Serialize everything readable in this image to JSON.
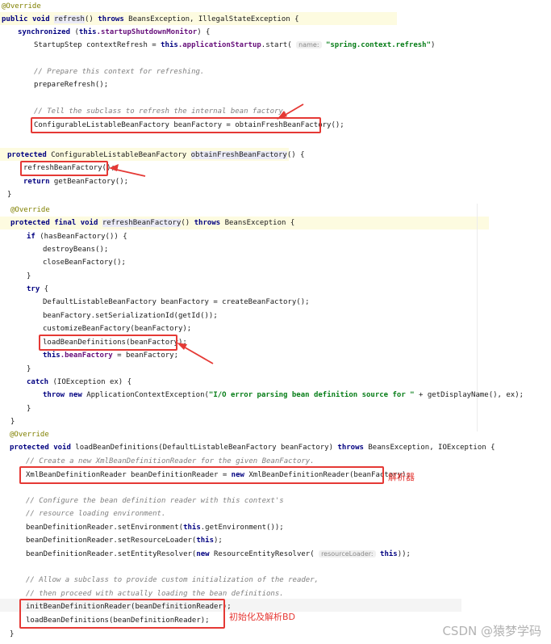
{
  "code": {
    "override": "@Override",
    "l1_public": "public",
    "l1_void": "void",
    "l1_refresh": "refresh",
    "l1_paren": "() ",
    "l1_throws": "throws",
    "l1_rest": " BeansException, IllegalStateException {",
    "l2_sync": "synchronized",
    "l2_paren": " (",
    "l2_this": "this",
    "l2_field": ".startupShutdownMonitor",
    "l2_rest": ") {",
    "l3_a": "StartupStep contextRefresh = ",
    "l3_this": "this",
    "l3_field": ".applicationStartup",
    "l3_b": ".start( ",
    "l3_hint": "name:",
    "l3_str": "\"spring.context.refresh\"",
    "l3_c": ")",
    "l4_cmt": "// Prepare this context for refreshing.",
    "l5": "prepareRefresh();",
    "l6_cmt": "// Tell the subclass to refresh the internal bean factory.",
    "l7": "ConfigurableListableBeanFactory beanFactory = obtainFreshBeanFactory();",
    "m2_protected": "protected",
    "m2_type": " ConfigurableListableBeanFactory ",
    "m2_name": "obtainFreshBeanFactory",
    "m2_rest": "() {",
    "m2_l1": "refreshBeanFactory();",
    "m2_return": "return",
    "m2_l2": " getBeanFactory();",
    "brace": "}",
    "m3_protected": "protected",
    "m3_final": "final",
    "m3_void": "void",
    "m3_name": "refreshBeanFactory",
    "m3_paren": "() ",
    "m3_throws": "throws",
    "m3_rest": " BeansException {",
    "m3_if": "if",
    "m3_ifrest": " (hasBeanFactory()) {",
    "m3_destroy": "destroyBeans();",
    "m3_close": "closeBeanFactory();",
    "m3_try": "try",
    "m3_tryrest": " {",
    "m3_create": "DefaultListableBeanFactory beanFactory = createBeanFactory();",
    "m3_serial": "beanFactory.setSerializationId(getId());",
    "m3_custom": "customizeBeanFactory(beanFactory);",
    "m3_load": "loadBeanDefinitions(beanFactory);",
    "m3_this": "this",
    "m3_field": ".beanFactory",
    "m3_assign": " = beanFactory;",
    "m3_catch": "catch",
    "m3_catchrest": " (IOException ex) {",
    "m3_throw": "throw",
    "m3_new": "new",
    "m3_exc": " ApplicationContextException(",
    "m3_str": "\"I/O error parsing bean definition source for \"",
    "m3_excrest": " + getDisplayName(), ex);",
    "m4_protected": "protected",
    "m4_void": "void",
    "m4_name": " loadBeanDefinitions(DefaultListableBeanFactory beanFactory) ",
    "m4_throws": "throws",
    "m4_rest": " BeansException, IOException {",
    "m4_cmt1": "// Create a new XmlBeanDefinitionReader for the given BeanFactory.",
    "m4_reader_a": "XmlBeanDefinitionReader beanDefinitionReader = ",
    "m4_reader_new": "new",
    "m4_reader_b": " XmlBeanDefinitionReader(beanFactory);",
    "m4_cmt2": "// Configure the bean definition reader with this context's",
    "m4_cmt3": "// resource loading environment.",
    "m4_env_a": "beanDefinitionReader.setEnvironment(",
    "m4_env_this": "this",
    "m4_env_b": ".getEnvironment());",
    "m4_rl_a": "beanDefinitionReader.setResourceLoader(",
    "m4_rl_this": "this",
    "m4_rl_b": ");",
    "m4_er_a": "beanDefinitionReader.setEntityResolver(",
    "m4_er_new": "new",
    "m4_er_b": " ResourceEntityResolver( ",
    "m4_er_hint": "resourceLoader:",
    "m4_er_this": " this",
    "m4_er_c": "));",
    "m4_cmt4": "// Allow a subclass to provide custom initialization of the reader,",
    "m4_cmt5": "// then proceed with actually loading the bean definitions.",
    "m4_init": "initBeanDefinitionReader(beanDefinitionReader);",
    "m4_load": "loadBeanDefinitions(beanDefinitionReader);"
  },
  "notes": {
    "parser": "解析器",
    "init_parse": "初始化及解析BD"
  },
  "watermark": "CSDN @猿梦学码",
  "colors": {
    "keyword": "#000080",
    "annotation": "#808000",
    "comment": "#808080",
    "string": "#067d17",
    "annotation_red": "#e53935"
  }
}
